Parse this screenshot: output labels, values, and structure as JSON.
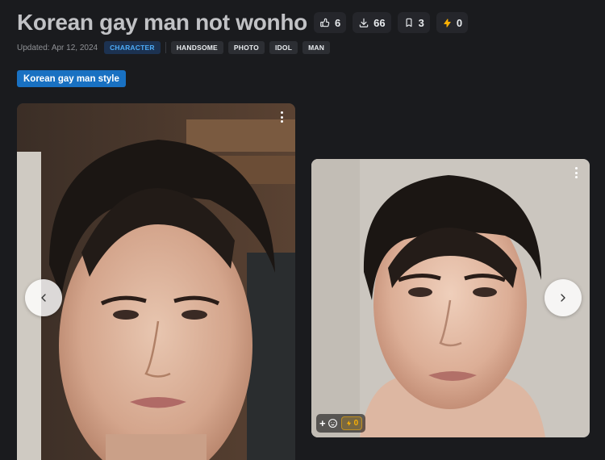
{
  "model": {
    "title": "Korean gay man not wonho",
    "stats": {
      "likes": "6",
      "downloads": "66",
      "bookmarks": "3",
      "buzz": "0"
    },
    "updated": "Updated: Apr 12, 2024",
    "primary_tag": "CHARACTER",
    "tags": [
      "HANDSOME",
      "PHOTO",
      "IDOL",
      "MAN"
    ],
    "trained_word": "Korean gay man style"
  },
  "gallery": {
    "images": [
      {
        "alt": "",
        "reactions": null
      },
      {
        "alt": "",
        "reactions": {
          "add_label": "+",
          "buzz_count": "0"
        }
      }
    ]
  },
  "colors": {
    "background": "#1a1b1e",
    "accent_blue": "#1971c2",
    "buzz_yellow": "#fab005",
    "tag_primary_text": "#4dabf7"
  },
  "icons": {
    "likes": "thumb-up-icon",
    "downloads": "download-icon",
    "bookmarks": "bookmark-icon",
    "buzz": "bolt-icon",
    "menu": "dots-vertical-icon",
    "prev": "chevron-left-icon",
    "next": "chevron-right-icon",
    "emoji": "emoji-add-icon"
  }
}
